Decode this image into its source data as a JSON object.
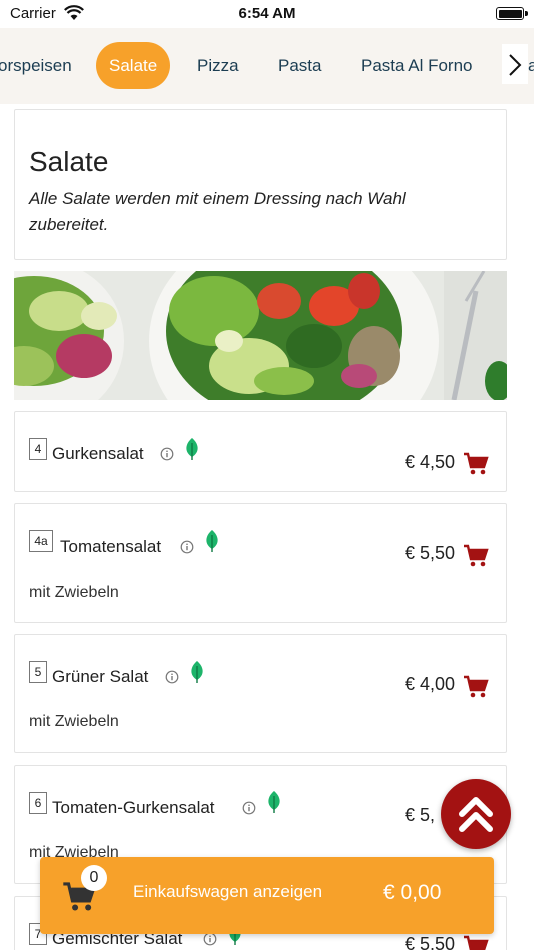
{
  "status_bar": {
    "carrier": "Carrier",
    "time": "6:54 AM"
  },
  "categories": {
    "tabs": [
      "orspeisen",
      "Salate",
      "Pizza",
      "Pasta",
      "Pasta Al Forno"
    ],
    "active": "Salate",
    "peek": "a"
  },
  "section": {
    "title": "Salate",
    "description": "Alle Salate werden mit einem Dressing nach Wahl zubereitet."
  },
  "items": [
    {
      "number": "4",
      "name": "Gurkensalat",
      "description": "",
      "price": "€ 4,50"
    },
    {
      "number": "4a",
      "name": "Tomatensalat",
      "description": "mit Zwiebeln",
      "price": "€ 5,50"
    },
    {
      "number": "5",
      "name": "Grüner Salat",
      "description": "mit Zwiebeln",
      "price": "€ 4,00"
    },
    {
      "number": "6",
      "name": "Tomaten-Gurkensalat",
      "description": "mit Zwiebeln",
      "price": "€ 5,"
    },
    {
      "number": "7",
      "name": "Gemischter Salat",
      "description": "",
      "price": "€ 5,50"
    }
  ],
  "cart": {
    "count": "0",
    "label": "Einkaufswagen anzeigen",
    "total": "€ 0,00"
  },
  "colors": {
    "accent": "#f7a12a",
    "cart_red": "#a31212",
    "leaf_green": "#1db46a",
    "nav_text": "#1c3d52"
  },
  "icons": [
    "wifi-icon",
    "battery-icon",
    "chevron-right-icon",
    "info-icon",
    "leaf-icon",
    "add-to-cart-icon",
    "double-chevron-up-icon",
    "shopping-cart-icon"
  ]
}
